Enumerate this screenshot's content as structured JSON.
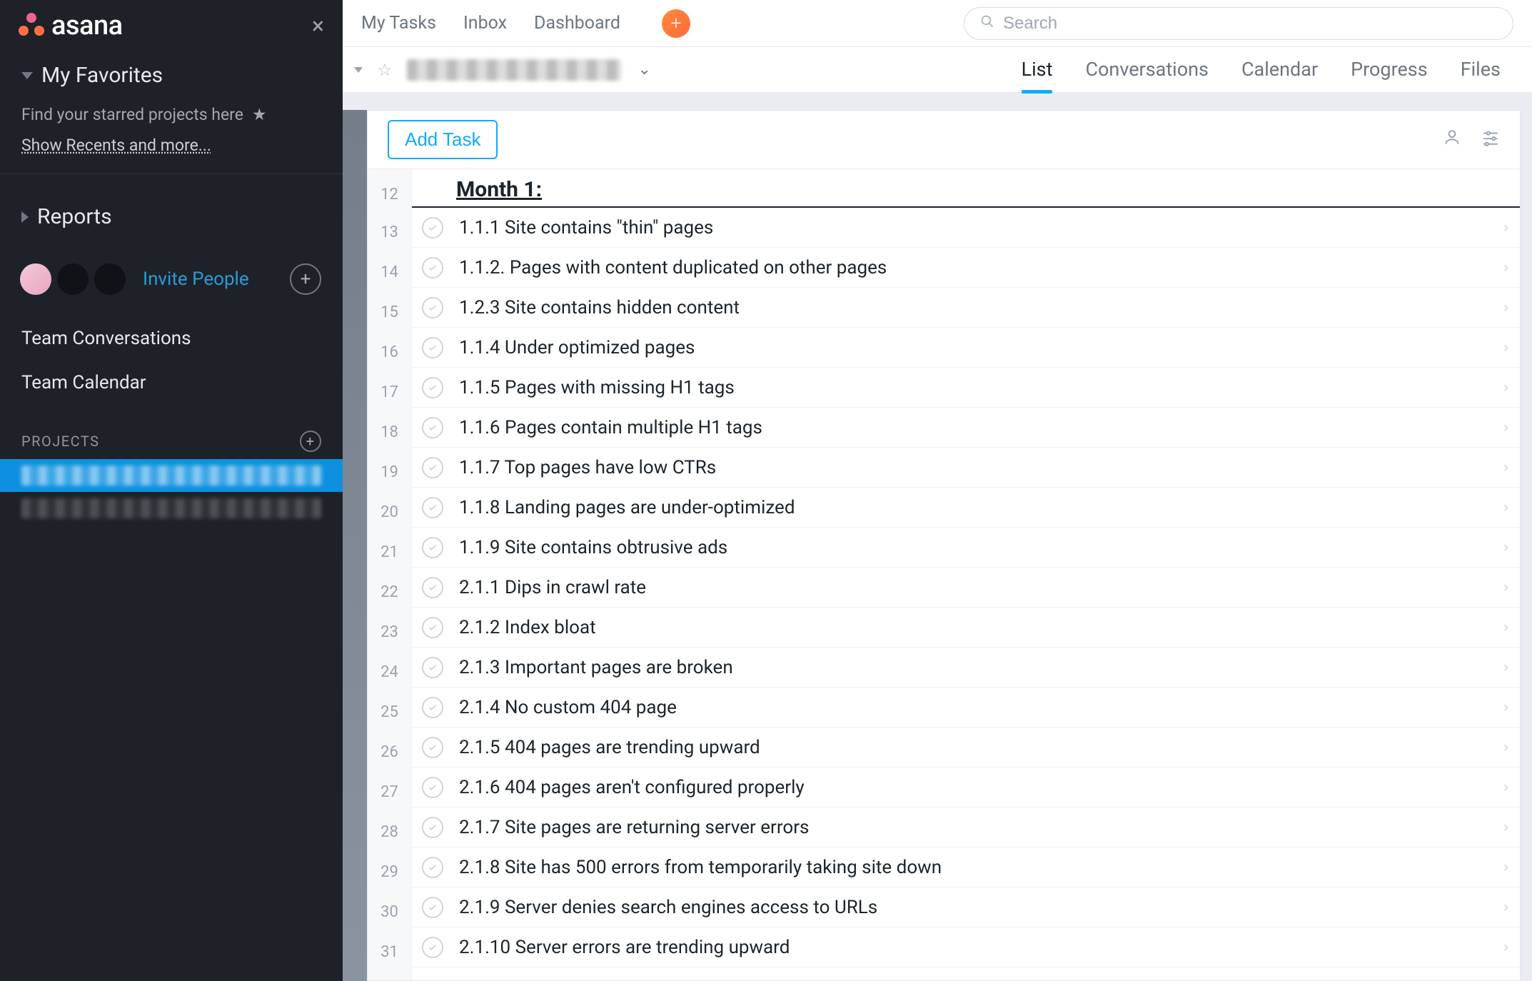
{
  "sidebar": {
    "brand": "asana",
    "favorites_header": "My Favorites",
    "favorites_empty": "Find your starred projects here",
    "show_recents": "Show Recents and more...",
    "reports_header": "Reports",
    "invite_label": "Invite People",
    "team_conversations": "Team Conversations",
    "team_calendar": "Team Calendar",
    "projects_header": "PROJECTS"
  },
  "topnav": {
    "my_tasks": "My Tasks",
    "inbox": "Inbox",
    "dashboard": "Dashboard"
  },
  "search": {
    "placeholder": "Search"
  },
  "viewtabs": {
    "list": "List",
    "conversations": "Conversations",
    "calendar": "Calendar",
    "progress": "Progress",
    "files": "Files"
  },
  "panel": {
    "add_task": "Add Task"
  },
  "list": {
    "start_number": 12,
    "section_title": "Month 1:",
    "tasks": [
      "1.1.1 Site contains \"thin\" pages",
      "1.1.2. Pages with content duplicated on other pages",
      "1.2.3 Site contains hidden content",
      "1.1.4 Under optimized pages",
      "1.1.5 Pages with missing H1 tags",
      "1.1.6 Pages contain multiple H1 tags",
      "1.1.7 Top pages have low CTRs",
      "1.1.8 Landing pages are under-optimized",
      "1.1.9 Site contains obtrusive ads",
      "2.1.1 Dips in crawl rate",
      "2.1.2 Index bloat",
      "2.1.3 Important pages are broken",
      "2.1.4 No custom 404 page",
      "2.1.5 404 pages are trending upward",
      "2.1.6 404 pages aren't configured properly",
      "2.1.7 Site pages are returning server errors",
      "2.1.8 Site has 500 errors from temporarily taking site down",
      "2.1.9 Server denies search engines access to URLs",
      "2.1.10 Server errors are trending upward"
    ]
  }
}
